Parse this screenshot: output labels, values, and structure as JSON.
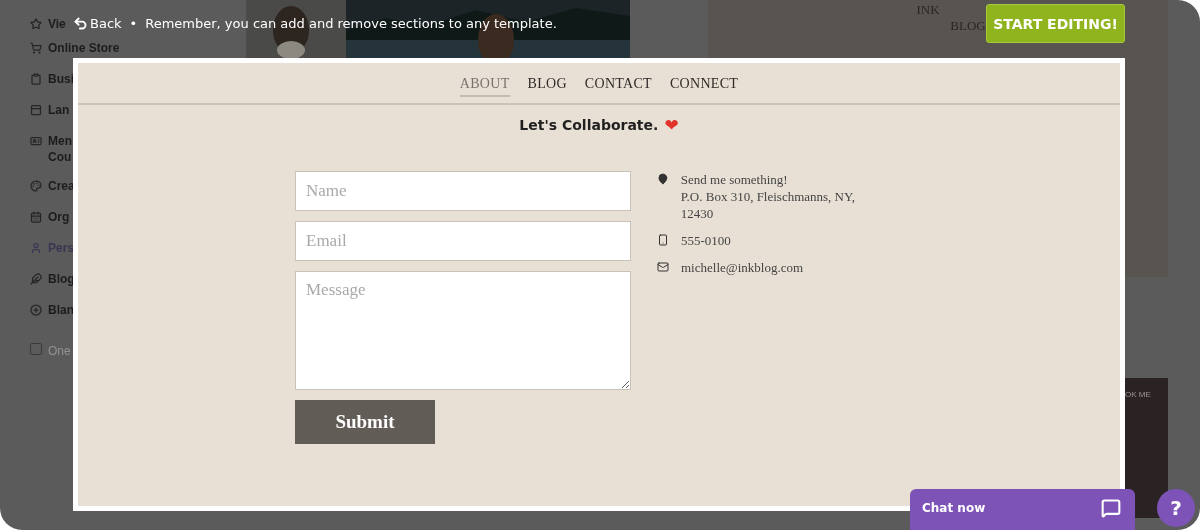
{
  "sidebar": {
    "items": [
      {
        "label": "Vie",
        "selected": false
      },
      {
        "label": "Online Store",
        "selected": false
      },
      {
        "label": "Busi",
        "selected": false
      },
      {
        "label": "Lan",
        "selected": false
      },
      {
        "label": "Men Cou",
        "selected": false
      },
      {
        "label": "Crea",
        "selected": false
      },
      {
        "label": "Org",
        "selected": false
      },
      {
        "label": "Pers",
        "selected": true
      },
      {
        "label": "Blog",
        "selected": false
      },
      {
        "label": "Blan",
        "selected": false
      },
      {
        "label": "One",
        "kind": "checkbox",
        "checked": false
      }
    ]
  },
  "top_bar": {
    "back": "Back",
    "separator": "•",
    "message": "Remember, you can add and remove sections to any template.",
    "start_button": "START EDITING!"
  },
  "background": {
    "logo_top": "INK",
    "logo_bottom": "BLOG",
    "side_text": "OK ME"
  },
  "preview": {
    "nav": [
      {
        "label": "ABOUT",
        "selected": true
      },
      {
        "label": "BLOG",
        "selected": false
      },
      {
        "label": "CONTACT",
        "selected": false
      },
      {
        "label": "CONNECT",
        "selected": false
      }
    ],
    "heading": "Let's Collaborate.",
    "heading_emoji": "❤",
    "form": {
      "fields": [
        {
          "kind": "input",
          "placeholder": "Name"
        },
        {
          "kind": "input",
          "placeholder": "Email"
        },
        {
          "kind": "textarea",
          "placeholder": "Message"
        }
      ],
      "submit": "Submit"
    },
    "contact": [
      {
        "kind": "address",
        "lines": [
          "Send me something!",
          "P.O. Box 310, Fleischmanns, NY, 12430"
        ]
      },
      {
        "kind": "phone",
        "lines": [
          "555-0100"
        ]
      },
      {
        "kind": "email",
        "lines": [
          "michelle@inkblog.com"
        ]
      }
    ]
  },
  "chat": {
    "label": "Chat now"
  },
  "help": {
    "label": "?"
  }
}
